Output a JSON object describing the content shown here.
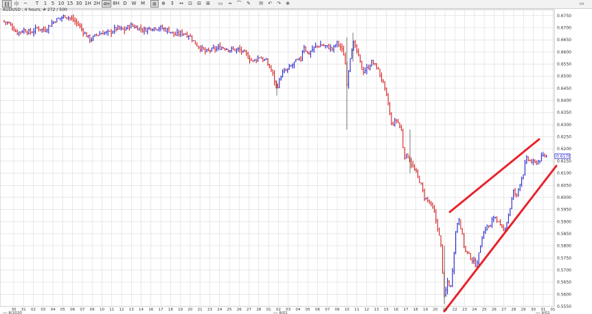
{
  "toolbar": {
    "items": [
      {
        "label": "‖‖",
        "icon": "bars-icon",
        "active": true
      },
      {
        "label": "ı|ı",
        "icon": "ohlc-icon",
        "active": false
      },
      {
        "label": "~",
        "icon": "line-icon",
        "active": false
      },
      {
        "label": "T",
        "active": false
      },
      {
        "label": "1",
        "active": false
      },
      {
        "label": "5",
        "active": false
      },
      {
        "label": "10",
        "active": false
      },
      {
        "label": "15",
        "active": false
      },
      {
        "label": "30",
        "active": false
      },
      {
        "label": "1H",
        "active": false
      },
      {
        "label": "2H",
        "active": false
      },
      {
        "label": "4H",
        "active": true
      },
      {
        "label": "8H",
        "active": false
      },
      {
        "label": "D",
        "active": false
      },
      {
        "label": "W",
        "active": false
      },
      {
        "label": "M",
        "active": false
      },
      {
        "label": "⊞",
        "icon": "crosshair-icon",
        "active": true
      },
      {
        "label": "⊕",
        "icon": "grid-icon",
        "active": false
      },
      {
        "label": "↕",
        "icon": "move-icon",
        "active": false
      },
      {
        "label": "↔",
        "icon": "pan-icon",
        "active": false
      },
      {
        "label": "⊡",
        "icon": "zoom-icon",
        "active": false
      },
      {
        "label": "⊟",
        "icon": "zoom-out-icon",
        "active": false
      },
      {
        "label": "⊞",
        "icon": "zoom-in-icon",
        "active": false
      },
      {
        "label": "▭",
        "icon": "box-icon",
        "active": false
      },
      {
        "label": "≈",
        "icon": "trendline-icon",
        "active": false
      },
      {
        "label": "⌒",
        "icon": "arc-icon",
        "active": false
      },
      {
        "label": "✎",
        "icon": "pen-icon",
        "active": false
      },
      {
        "label": "✉",
        "icon": "print-icon",
        "active": false
      },
      {
        "label": "↶",
        "icon": "undo-icon",
        "active": false
      },
      {
        "label": "↷",
        "icon": "redo-icon",
        "active": false
      },
      {
        "label": "⊗",
        "icon": "reset-icon",
        "active": false
      }
    ],
    "right_icon": "window-icon"
  },
  "ticker_label": "AUDUSD , 4 hours, # 272 / 500",
  "current_price": "0.6170",
  "price_labels": [
    "0.6750",
    "0.6700",
    "0.6650",
    "0.6600",
    "0.6550",
    "0.6500",
    "0.6450",
    "0.6400",
    "0.6350",
    "0.6300",
    "0.6250",
    "0.6200",
    "0.6150",
    "0.6100",
    "0.6050",
    "0.6000",
    "0.5950",
    "0.5900",
    "0.5850",
    "0.5800",
    "0.5750",
    "0.5700",
    "0.5650",
    "0.5600",
    "0.5550"
  ],
  "day_labels": [
    "30",
    "31",
    "02",
    "03",
    "04",
    "05",
    "06",
    "07",
    "09",
    "10",
    "11",
    "12",
    "13",
    "14",
    "16",
    "17",
    "18",
    "19",
    "20",
    "21",
    "23",
    "24",
    "25",
    "26",
    "27",
    "28",
    "01",
    "02",
    "03",
    "04",
    "05",
    "06",
    "07",
    "09",
    "10",
    "11",
    "12",
    "13",
    "15",
    "16",
    "17",
    "18",
    "19",
    "20",
    "21",
    "22",
    "23",
    "24",
    "25",
    "26",
    "27",
    "28",
    "29",
    "30",
    "31",
    "01"
  ],
  "month_labels": [
    "8/2020",
    "8/01",
    "9/01"
  ],
  "colors": {
    "up": "#1f1fcc",
    "down": "#d41a1a",
    "trendline": "#e8222a",
    "grid": "#d9d9d9",
    "axis": "#333333"
  },
  "chart_data": {
    "type": "ohlc-4h-bars",
    "symbol": "AUDUSD",
    "timeframe": "4 hours",
    "ylim": [
      0.555,
      0.6775
    ],
    "y_axis": "right",
    "x_axis_labels": "day of month",
    "price_path": [
      [
        0,
        0.673
      ],
      [
        12,
        0.672
      ],
      [
        25,
        0.668
      ],
      [
        35,
        0.669
      ],
      [
        45,
        0.668
      ],
      [
        55,
        0.67
      ],
      [
        65,
        0.669
      ],
      [
        80,
        0.673
      ],
      [
        95,
        0.675
      ],
      [
        108,
        0.673
      ],
      [
        115,
        0.671
      ],
      [
        122,
        0.668
      ],
      [
        132,
        0.665
      ],
      [
        140,
        0.667
      ],
      [
        150,
        0.668
      ],
      [
        160,
        0.668
      ],
      [
        170,
        0.67
      ],
      [
        180,
        0.669
      ],
      [
        190,
        0.671
      ],
      [
        200,
        0.67
      ],
      [
        210,
        0.669
      ],
      [
        220,
        0.67
      ],
      [
        232,
        0.67
      ],
      [
        245,
        0.669
      ],
      [
        255,
        0.667
      ],
      [
        265,
        0.668
      ],
      [
        275,
        0.667
      ],
      [
        283,
        0.664
      ],
      [
        290,
        0.662
      ],
      [
        300,
        0.66
      ],
      [
        310,
        0.661
      ],
      [
        322,
        0.662
      ],
      [
        335,
        0.661
      ],
      [
        348,
        0.661
      ],
      [
        358,
        0.659
      ],
      [
        368,
        0.656
      ],
      [
        378,
        0.658
      ],
      [
        388,
        0.656
      ],
      [
        396,
        0.652
      ],
      [
        403,
        0.645
      ],
      [
        410,
        0.651
      ],
      [
        420,
        0.653
      ],
      [
        430,
        0.656
      ],
      [
        438,
        0.657
      ],
      [
        442,
        0.663
      ],
      [
        448,
        0.659
      ],
      [
        458,
        0.662
      ],
      [
        468,
        0.663
      ],
      [
        478,
        0.662
      ],
      [
        485,
        0.661
      ],
      [
        490,
        0.664
      ],
      [
        496,
        0.662
      ],
      [
        502,
        0.658
      ],
      [
        505,
        0.647
      ],
      [
        510,
        0.658
      ],
      [
        514,
        0.664
      ],
      [
        520,
        0.66
      ],
      [
        528,
        0.652
      ],
      [
        534,
        0.653
      ],
      [
        542,
        0.656
      ],
      [
        550,
        0.653
      ],
      [
        558,
        0.647
      ],
      [
        565,
        0.639
      ],
      [
        570,
        0.63
      ],
      [
        578,
        0.632
      ],
      [
        585,
        0.627
      ],
      [
        588,
        0.617
      ],
      [
        595,
        0.617
      ],
      [
        600,
        0.613
      ],
      [
        606,
        0.61
      ],
      [
        612,
        0.606
      ],
      [
        618,
        0.6
      ],
      [
        625,
        0.598
      ],
      [
        632,
        0.594
      ],
      [
        637,
        0.588
      ],
      [
        642,
        0.58
      ],
      [
        647,
        0.558
      ],
      [
        652,
        0.566
      ],
      [
        656,
        0.562
      ],
      [
        660,
        0.574
      ],
      [
        664,
        0.587
      ],
      [
        668,
        0.592
      ],
      [
        672,
        0.586
      ],
      [
        677,
        0.578
      ],
      [
        683,
        0.576
      ],
      [
        688,
        0.574
      ],
      [
        693,
        0.572
      ],
      [
        697,
        0.576
      ],
      [
        702,
        0.584
      ],
      [
        708,
        0.588
      ],
      [
        714,
        0.588
      ],
      [
        718,
        0.592
      ],
      [
        722,
        0.592
      ],
      [
        728,
        0.588
      ],
      [
        733,
        0.586
      ],
      [
        738,
        0.59
      ],
      [
        743,
        0.596
      ],
      [
        748,
        0.603
      ],
      [
        752,
        0.6
      ],
      [
        757,
        0.606
      ],
      [
        762,
        0.61
      ],
      [
        766,
        0.616
      ],
      [
        772,
        0.615
      ],
      [
        778,
        0.614
      ],
      [
        784,
        0.615
      ],
      [
        790,
        0.617
      ]
    ],
    "trendlines": [
      {
        "name": "upper",
        "from": [
          655,
          0.594
        ],
        "to": [
          785,
          0.624
        ]
      },
      {
        "name": "lower",
        "from": [
          647,
          0.553
        ],
        "to": [
          810,
          0.613
        ]
      }
    ]
  }
}
